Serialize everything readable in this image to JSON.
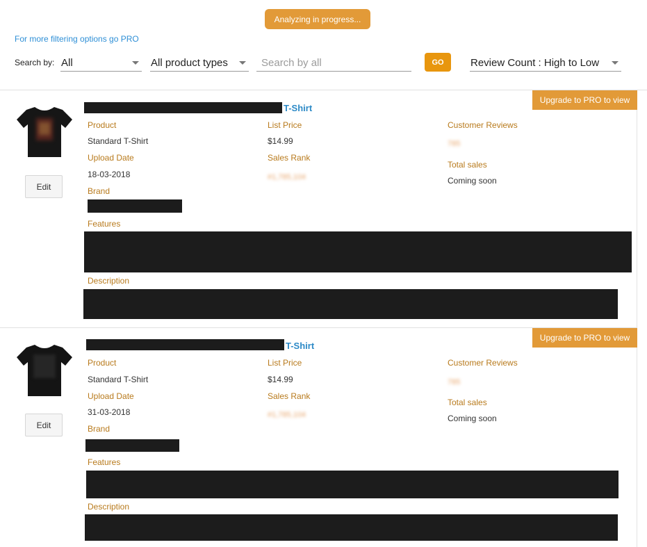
{
  "header": {
    "status_label": "Analyzing in progress...",
    "pro_link": "For more filtering options go PRO",
    "search_by_label": "Search by:",
    "search_by_value": "All",
    "product_type_value": "All product types",
    "search_placeholder": "Search by all",
    "go_label": "GO",
    "sort_value": "Review Count : High to Low"
  },
  "labels": {
    "product": "Product",
    "list_price": "List Price",
    "customer_reviews": "Customer Reviews",
    "upload_date": "Upload Date",
    "sales_rank": "Sales Rank",
    "total_sales": "Total sales",
    "brand": "Brand",
    "features": "Features",
    "description": "Description",
    "edit": "Edit",
    "upgrade": "Upgrade to PRO to view"
  },
  "products": [
    {
      "title_suffix": "T-Shirt",
      "product": "Standard T-Shirt",
      "list_price": "$14.99",
      "reviews": "785",
      "upload_date": "18-03-2018",
      "sales_rank": "#1,785,104",
      "total_sales": "Coming soon"
    },
    {
      "title_suffix": "T-Shirt",
      "product": "Standard T-Shirt",
      "list_price": "$14.99",
      "reviews": "785",
      "upload_date": "31-03-2018",
      "sales_rank": "#1,785,104",
      "total_sales": "Coming soon"
    }
  ],
  "colors": {
    "accent": "#e29a38",
    "go": "#e8960e",
    "label": "#b87a1c",
    "link": "#2d8ac7"
  }
}
